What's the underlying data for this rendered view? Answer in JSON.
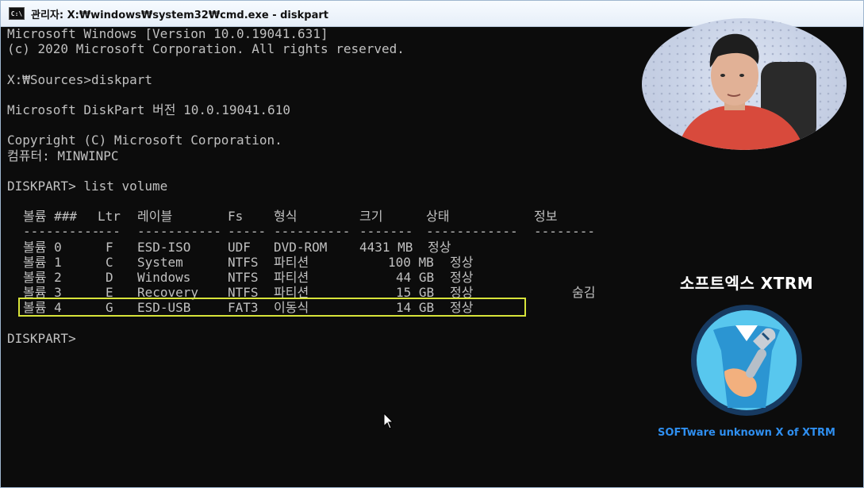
{
  "window": {
    "title": "관리자: X:₩windows₩system32₩cmd.exe - diskpart",
    "icon_label": "C:\\"
  },
  "console": {
    "lines": [
      "Microsoft Windows [Version 10.0.19041.631]",
      "(c) 2020 Microsoft Corporation. All rights reserved.",
      "",
      "X:₩Sources>diskpart",
      "",
      "Microsoft DiskPart 버전 10.0.19041.610",
      "",
      "Copyright (C) Microsoft Corporation.",
      "컴퓨터: MINWINPC",
      "",
      "DISKPART> list volume",
      ""
    ],
    "table": {
      "headers": [
        "볼륨 ###",
        "Ltr",
        "레이블",
        "Fs",
        "형식",
        "크기",
        "상태",
        "정보"
      ],
      "separators": [
        "----------",
        "---",
        "-----------",
        "-----",
        "----------",
        "-------",
        "------------",
        "--------"
      ],
      "rows": [
        [
          "볼륨 0",
          "F",
          "ESD-ISO",
          "UDF",
          "DVD-ROM",
          "4431 MB",
          "정상",
          ""
        ],
        [
          "볼륨 1",
          "C",
          "System",
          "NTFS",
          "파티션",
          "100 MB",
          "정상",
          ""
        ],
        [
          "볼륨 2",
          "D",
          "Windows",
          "NTFS",
          "파티션",
          "44 GB",
          "정상",
          ""
        ],
        [
          "볼륨 3",
          "E",
          "Recovery",
          "NTFS",
          "파티션",
          "15 GB",
          "정상",
          "숨김"
        ],
        [
          "볼륨 4",
          "G",
          "ESD-USB",
          "FAT3",
          "이동식",
          "14 GB",
          "정상",
          ""
        ]
      ],
      "highlight_row_index": 4
    },
    "prompt": "DISKPART>"
  },
  "branding": {
    "title": "소프트엑스 XTRM",
    "subtitle": "SOFTware unknown X of XTRM"
  },
  "colors": {
    "console_bg": "#0c0c0c",
    "console_text": "#c0c0c0",
    "highlight": "#d7e33a",
    "brand_sub": "#2f8ff0"
  }
}
